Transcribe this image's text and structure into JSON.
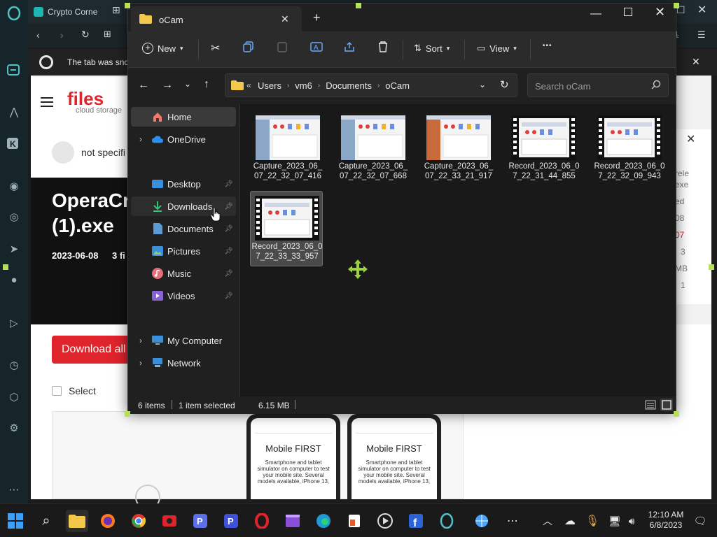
{
  "opera": {
    "tab_title": "Crypto Corne",
    "notification": "The tab was sno",
    "site_logo": "files",
    "site_logo_sub": "cloud storage",
    "user_text": "not specifi",
    "page_title_1": "OperaCr",
    "page_title_2": "(1).exe",
    "meta": "2023-06-08",
    "meta_sep": "3 fi",
    "download_btn": "Download all",
    "select_label": "Select",
    "right_col": [
      "rele",
      "exe",
      "ed",
      "08",
      "07",
      "3",
      "MB",
      "1"
    ],
    "phone_headline": "Mobile FIRST",
    "phone_brand": "Mobile FIRST",
    "phone_body": "Smartphone and tablet simulator on computer to test your mobile site. Several models available, iPhone 13,"
  },
  "explorer": {
    "tab_title": "oCam",
    "toolbar": {
      "new_label": "New",
      "sort_label": "Sort",
      "view_label": "View",
      "more_label": "•••"
    },
    "breadcrumb": [
      "Users",
      "vm6",
      "Documents",
      "oCam"
    ],
    "breadcrumb_prefix": "«",
    "search_placeholder": "Search oCam",
    "nav": {
      "home": "Home",
      "onedrive": "OneDrive",
      "desktop": "Desktop",
      "downloads": "Downloads",
      "documents": "Documents",
      "pictures": "Pictures",
      "music": "Music",
      "videos": "Videos",
      "my_computer": "My Computer",
      "network": "Network"
    },
    "files": [
      {
        "name": "Capture_2023_06_07_22_32_07_416",
        "kind": "image"
      },
      {
        "name": "Capture_2023_06_07_22_32_07_668",
        "kind": "image"
      },
      {
        "name": "Capture_2023_06_07_22_33_21_917",
        "kind": "image"
      },
      {
        "name": "Record_2023_06_07_22_31_44_855",
        "kind": "video"
      },
      {
        "name": "Record_2023_06_07_22_32_09_943",
        "kind": "video"
      },
      {
        "name": "Record_2023_06_07_22_33_33_957",
        "kind": "video",
        "selected": true
      }
    ],
    "status": {
      "items": "6 items",
      "selected": "1 item selected",
      "size": "6.15 MB"
    }
  },
  "taskbar": {
    "time": "12:10 AM",
    "date": "6/8/2023"
  },
  "colors": {
    "accent_blue": "#4aa3ff",
    "folder_yellow": "#f3c84b",
    "opera_red": "#e0242c",
    "handle_green": "#b6e05a"
  }
}
